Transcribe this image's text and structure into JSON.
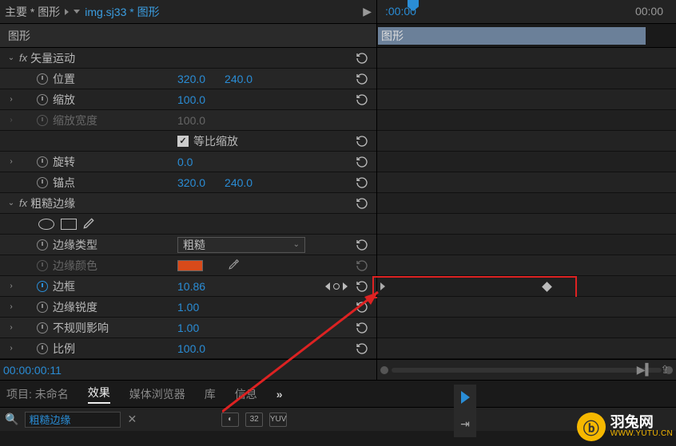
{
  "header": {
    "crumb1": "主要 * 图形",
    "crumb2": "img.sj33 * 图形",
    "tc_left": ":00:00",
    "tc_right": "00:00"
  },
  "row2": {
    "panel_label": "图形",
    "clip_label": "图形"
  },
  "effects": {
    "vector": {
      "title": "矢量运动",
      "position": {
        "label": "位置",
        "x": "320.0",
        "y": "240.0"
      },
      "scale": {
        "label": "缩放",
        "value": "100.0"
      },
      "scaleW": {
        "label": "缩放宽度",
        "value": "100.0"
      },
      "uniform": {
        "label": "等比缩放"
      },
      "rotation": {
        "label": "旋转",
        "value": "0.0"
      },
      "anchor": {
        "label": "锚点",
        "x": "320.0",
        "y": "240.0"
      }
    },
    "rough": {
      "title": "粗糙边缘",
      "edgeType": {
        "label": "边缘类型",
        "value": "粗糙"
      },
      "edgeColor": {
        "label": "边缘颜色",
        "hex": "#d84a1a"
      },
      "border": {
        "label": "边框",
        "value": "10.86"
      },
      "sharpness": {
        "label": "边缘锐度",
        "value": "1.00"
      },
      "irregular": {
        "label": "不规则影响",
        "value": "1.00"
      },
      "proportion": {
        "label": "比例",
        "value": "100.0"
      }
    }
  },
  "timecode": "00:00:00:11",
  "tabs": {
    "project": "项目: 未命名",
    "effects": "效果",
    "media": "媒体浏览器",
    "library": "库",
    "info": "信息",
    "more": "»"
  },
  "search": {
    "value": "粗糙边缘",
    "btn32": "32",
    "btnYUV": "YUV"
  },
  "brand": {
    "name": "羽兔网",
    "url": "WWW.YUTU.CN"
  }
}
